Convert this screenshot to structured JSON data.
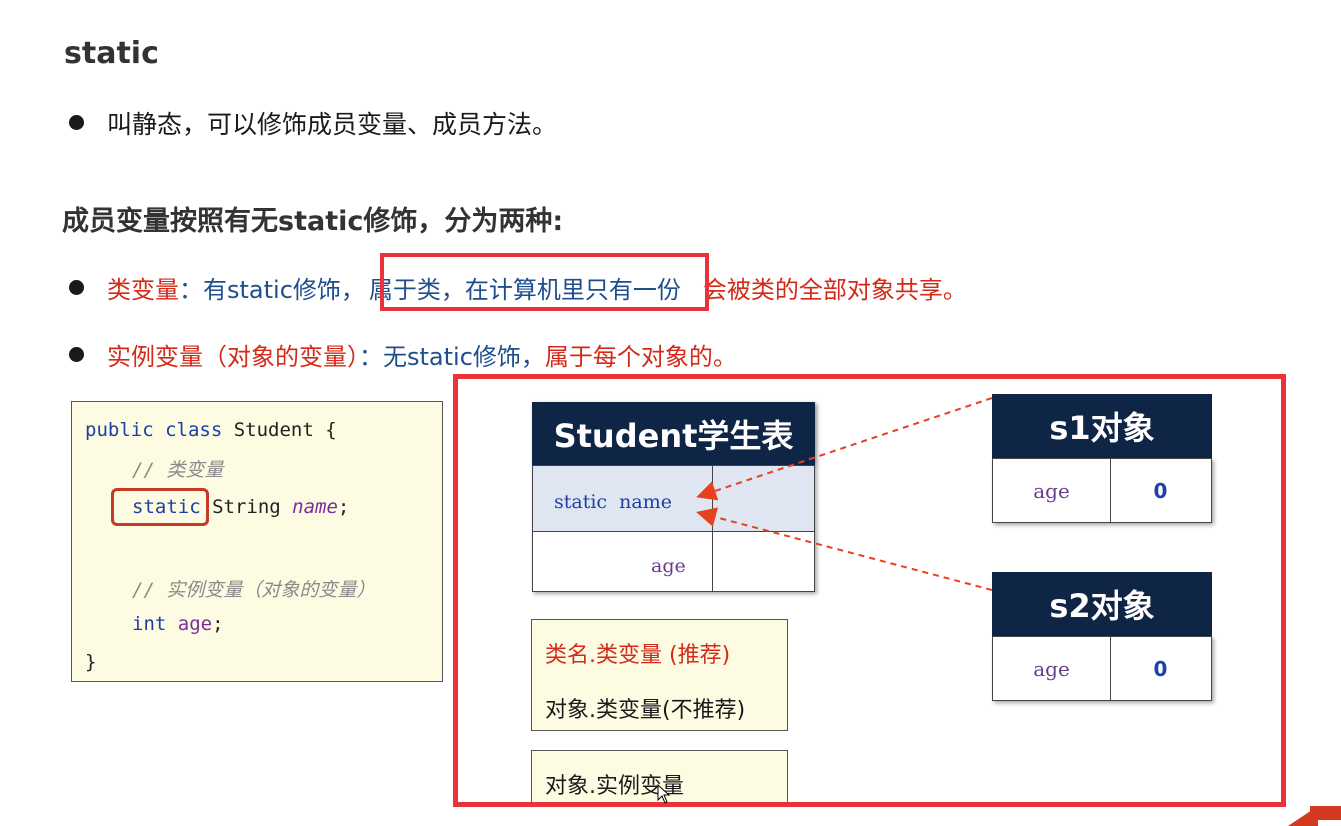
{
  "title": "static",
  "bullet1": "叫静态，可以修饰成员变量、成员方法。",
  "subtitle": "成员变量按照有无static修饰，分为两种:",
  "bullet2": {
    "term": "类变量",
    "colon": "：",
    "part1": "有static修饰，",
    "highlight": "属于类，在计算机里只有一份",
    "part2": "会被类的全部对象共享。"
  },
  "bullet3": {
    "term": "实例变量（对象的变量）",
    "colon": "：",
    "part1": "无static修饰，",
    "part2": "属于每个对象的。"
  },
  "code": {
    "l1_kw": "public class",
    "l1_rest": " Student {",
    "l2_comment": "// 类变量",
    "l3_kw": "static",
    "l3_type": " String ",
    "l3_field": "name",
    "l3_end": ";",
    "l5_comment": "// 实例变量（对象的变量）",
    "l6_kw": "int",
    "l6_field": "age",
    "l6_end": ";",
    "l7": "}"
  },
  "student_table": {
    "header": "Student学生表",
    "row1": "static  name",
    "row2": "age"
  },
  "objects": [
    {
      "header": "s1对象",
      "key": "age",
      "value": "0"
    },
    {
      "header": "s2对象",
      "key": "age",
      "value": "0"
    }
  ],
  "notes": {
    "recommended": "类名.类变量 (推荐)",
    "not_recommended": "对象.类变量(不推荐)",
    "instance": "对象.实例变量"
  },
  "colors": {
    "accent_red": "#e8333a",
    "dark_navy": "#0f2546",
    "term_red": "#d42a1a",
    "text_blue": "#1f4e8c"
  }
}
